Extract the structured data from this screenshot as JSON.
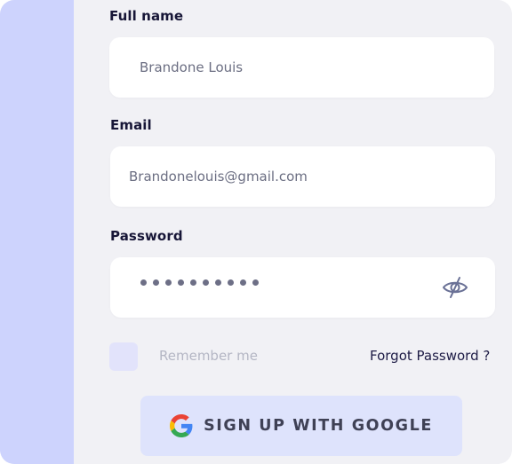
{
  "form": {
    "full_name": {
      "label": "Full name",
      "value": "Brandone Louis"
    },
    "email": {
      "label": "Email",
      "value": "Brandonelouis@gmail.com"
    },
    "password": {
      "label": "Password",
      "masked_char_count": 10,
      "visibility_icon": "eye-off-icon"
    },
    "remember_me": {
      "label": "Remember me",
      "checked": false
    },
    "forgot_password_label": "Forgot Password ?",
    "google_button": {
      "label": "SIGN UP WITH GOOGLE",
      "icon": "google-icon"
    }
  },
  "colors": {
    "side_accent": "#cdd3fd",
    "panel_background": "#f1f1f5",
    "field_background": "#ffffff",
    "label_text": "#171637",
    "value_text": "#6b6e82",
    "google_button_background": "#dee3fc"
  }
}
